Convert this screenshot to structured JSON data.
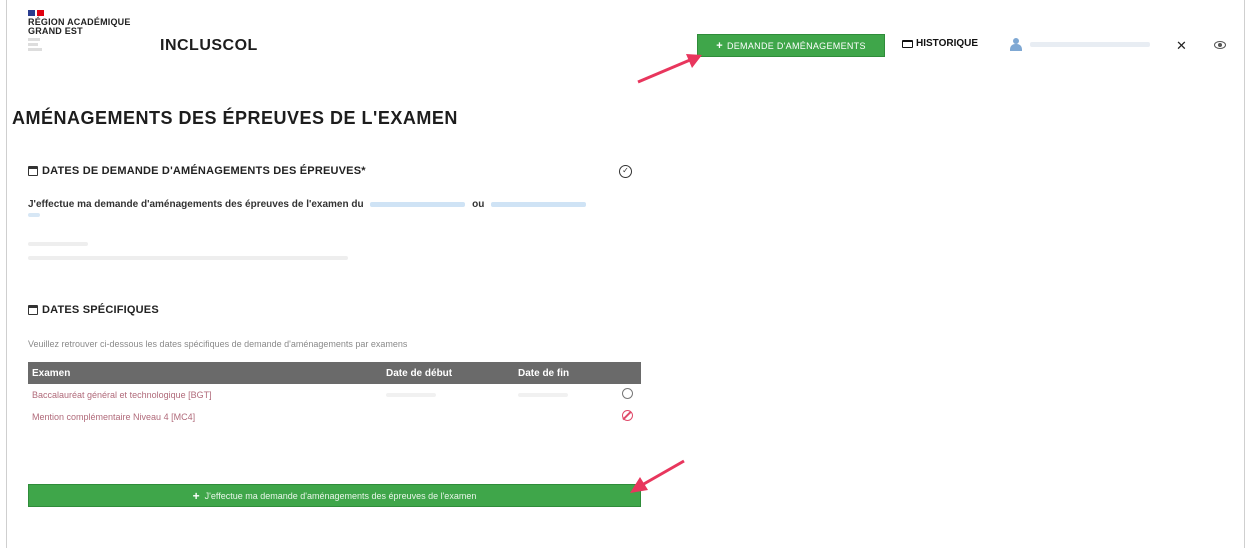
{
  "header": {
    "logo_lines": [
      "RÉGION ACADÉMIQUE",
      "GRAND EST"
    ],
    "app_title": "INCLUSCOL",
    "demande_button": "DEMANDE D'AMÉNAGEMENTS",
    "historique": "HISTORIQUE",
    "icons": [
      "france-flag-icon",
      "folder-icon",
      "user-icon",
      "tools-icon",
      "eye-icon"
    ]
  },
  "page": {
    "title": "AMÉNAGEMENTS DES ÉPREUVES DE L'EXAMEN"
  },
  "dates_demande": {
    "title": "DATES DE DEMANDE D'AMÉNAGEMENTS DES ÉPREUVES*",
    "text": "J'effectue ma demande d'aménagements des épreuves de l'examen du",
    "connector": "ou"
  },
  "dates_specifiques": {
    "title": "DATES SPÉCIFIQUES",
    "description": "Veuillez retrouver ci-dessous les dates spécifiques de demande d'aménagements par examens",
    "columns": [
      "Examen",
      "Date de début",
      "Date de fin"
    ],
    "rows": [
      {
        "examen": "Baccalauréat général et technologique [BGT]"
      },
      {
        "examen": "Mention complémentaire Niveau 4 [MC4]"
      }
    ],
    "submit_button": "J'effectue ma demande d'aménagements des épreuves de l'examen"
  },
  "colors": {
    "green": "#3fa64a",
    "table_header": "#6a6a6a",
    "arrow": "#e8365d",
    "link_row": "#b06a7a"
  }
}
